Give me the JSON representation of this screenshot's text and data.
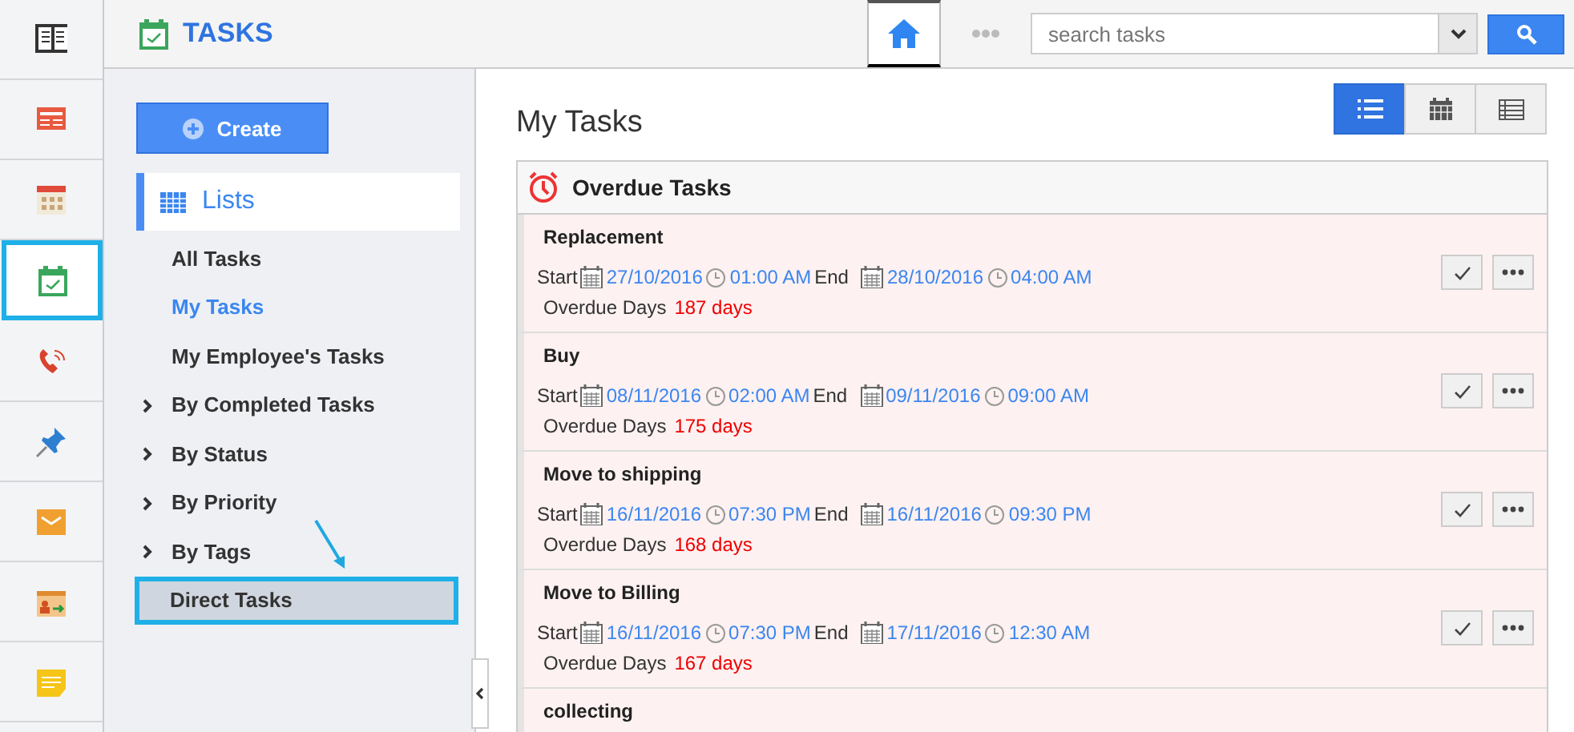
{
  "app_rail": [
    {
      "kind": "book",
      "selected": false
    },
    {
      "kind": "newspaper",
      "selected": false
    },
    {
      "kind": "calendar",
      "selected": false
    },
    {
      "kind": "tasks",
      "selected": true
    },
    {
      "kind": "phone",
      "selected": false
    },
    {
      "kind": "pin",
      "selected": false
    },
    {
      "kind": "mail",
      "selected": false
    },
    {
      "kind": "transfer",
      "selected": false
    },
    {
      "kind": "note",
      "selected": false
    }
  ],
  "header": {
    "title": "TASKS",
    "search": {
      "placeholder": "search tasks"
    }
  },
  "sidebar": {
    "create_button": "Create",
    "lists_heading": "Lists",
    "items": [
      {
        "label": "All Tasks",
        "kind": "link",
        "selected": false,
        "highlighted": false
      },
      {
        "label": "My Tasks",
        "kind": "link",
        "selected": true,
        "highlighted": false
      },
      {
        "label": "My Employee's Tasks",
        "kind": "link",
        "selected": false,
        "highlighted": false
      },
      {
        "label": "By Completed Tasks",
        "kind": "group",
        "selected": false,
        "highlighted": false
      },
      {
        "label": "By Status",
        "kind": "group",
        "selected": false,
        "highlighted": false
      },
      {
        "label": "By Priority",
        "kind": "group",
        "selected": false,
        "highlighted": false
      },
      {
        "label": "By Tags",
        "kind": "group",
        "selected": false,
        "highlighted": false
      },
      {
        "label": "Direct Tasks",
        "kind": "link",
        "selected": false,
        "highlighted": true
      }
    ]
  },
  "main": {
    "title": "My Tasks",
    "view_buttons": [
      {
        "kind": "list",
        "selected": true
      },
      {
        "kind": "calendar",
        "selected": false
      },
      {
        "kind": "table",
        "selected": false
      }
    ],
    "section_title": "Overdue Tasks",
    "tasks": [
      {
        "name": "Replacement",
        "start_label": "Start",
        "start_date": "27/10/2016",
        "start_time": "01:00 AM",
        "end_label": "End",
        "end_date": "28/10/2016",
        "end_time": "04:00 AM",
        "overdue_label": "Overdue Days",
        "overdue_value": "187 days"
      },
      {
        "name": "Buy",
        "start_label": "Start",
        "start_date": "08/11/2016",
        "start_time": "02:00 AM",
        "end_label": "End",
        "end_date": "09/11/2016",
        "end_time": "09:00 AM",
        "overdue_label": "Overdue Days",
        "overdue_value": "175 days"
      },
      {
        "name": "Move to shipping",
        "start_label": "Start",
        "start_date": "16/11/2016",
        "start_time": "07:30 PM",
        "end_label": "End",
        "end_date": "16/11/2016",
        "end_time": "09:30 PM",
        "overdue_label": "Overdue Days",
        "overdue_value": "168 days"
      },
      {
        "name": "Move to Billing",
        "start_label": "Start",
        "start_date": "16/11/2016",
        "start_time": "07:30 PM",
        "end_label": "End",
        "end_date": "17/11/2016",
        "end_time": "12:30 AM",
        "overdue_label": "Overdue Days",
        "overdue_value": "167 days"
      },
      {
        "name": "collecting"
      }
    ]
  }
}
